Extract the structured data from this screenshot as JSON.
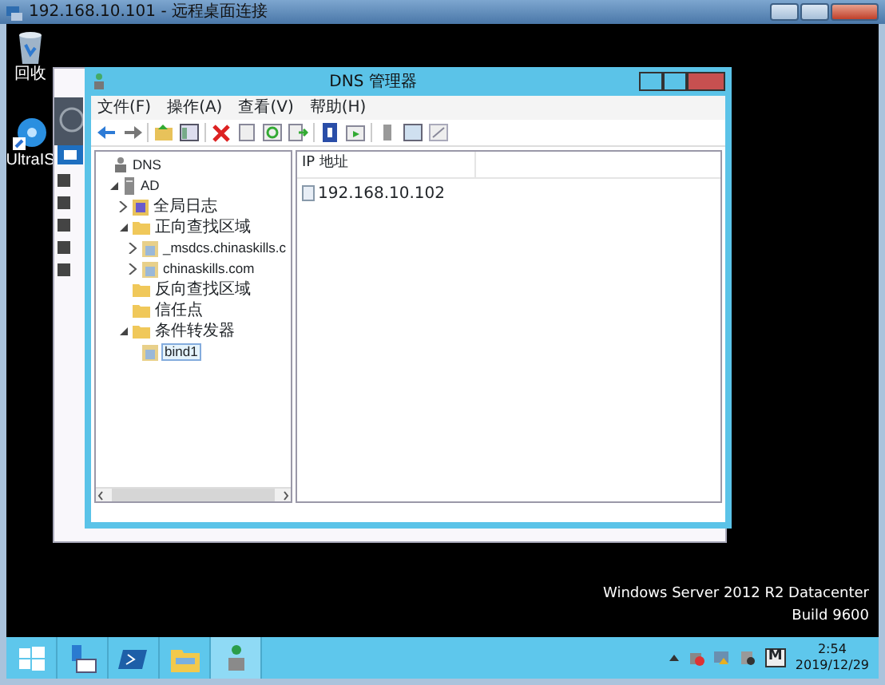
{
  "remote_window": {
    "title": "192.168.10.101 - 远程桌面连接"
  },
  "desktop_icons": [
    {
      "label": "回收",
      "kind": "recycle"
    },
    {
      "label": "UltraIS",
      "kind": "disc"
    }
  ],
  "dns_window": {
    "title": "DNS 管理器",
    "menu": [
      "文件(F)",
      "操作(A)",
      "查看(V)",
      "帮助(H)"
    ],
    "tree": [
      {
        "label": "DNS",
        "kind": "root",
        "selected": false,
        "children": [
          {
            "label": "AD",
            "kind": "server",
            "expanded": true,
            "selected": false,
            "children": [
              {
                "label": "全局日志",
                "kind": "log",
                "expanded": false,
                "selected": false
              },
              {
                "label": "正向查找区域",
                "kind": "folder",
                "expanded": true,
                "selected": false,
                "children": [
                  {
                    "label": "_msdcs.chinaskills.c",
                    "kind": "zone",
                    "expanded": false,
                    "selected": false
                  },
                  {
                    "label": "chinaskills.com",
                    "kind": "zone",
                    "expanded": false,
                    "selected": false
                  }
                ]
              },
              {
                "label": "反向查找区域",
                "kind": "folder",
                "selected": false
              },
              {
                "label": "信任点",
                "kind": "folder",
                "selected": false
              },
              {
                "label": "条件转发器",
                "kind": "folder",
                "expanded": true,
                "selected": false,
                "children": [
                  {
                    "label": "bind1",
                    "kind": "zone",
                    "selected": true
                  }
                ]
              }
            ]
          }
        ]
      }
    ],
    "list_columns": [
      "IP 地址"
    ],
    "list_rows": [
      "192.168.10.102"
    ]
  },
  "os_info": [
    "Windows Server 2012 R2 Datacenter",
    "Build 9600"
  ],
  "taskbar": {
    "apps": [
      {
        "kind": "start",
        "selected": false
      },
      {
        "kind": "server",
        "selected": false
      },
      {
        "kind": "shell",
        "selected": false
      },
      {
        "kind": "explorer",
        "selected": false
      },
      {
        "kind": "dns",
        "selected": true
      }
    ],
    "tray_label": "M",
    "time": "2:54",
    "date": "2019/12/29"
  }
}
